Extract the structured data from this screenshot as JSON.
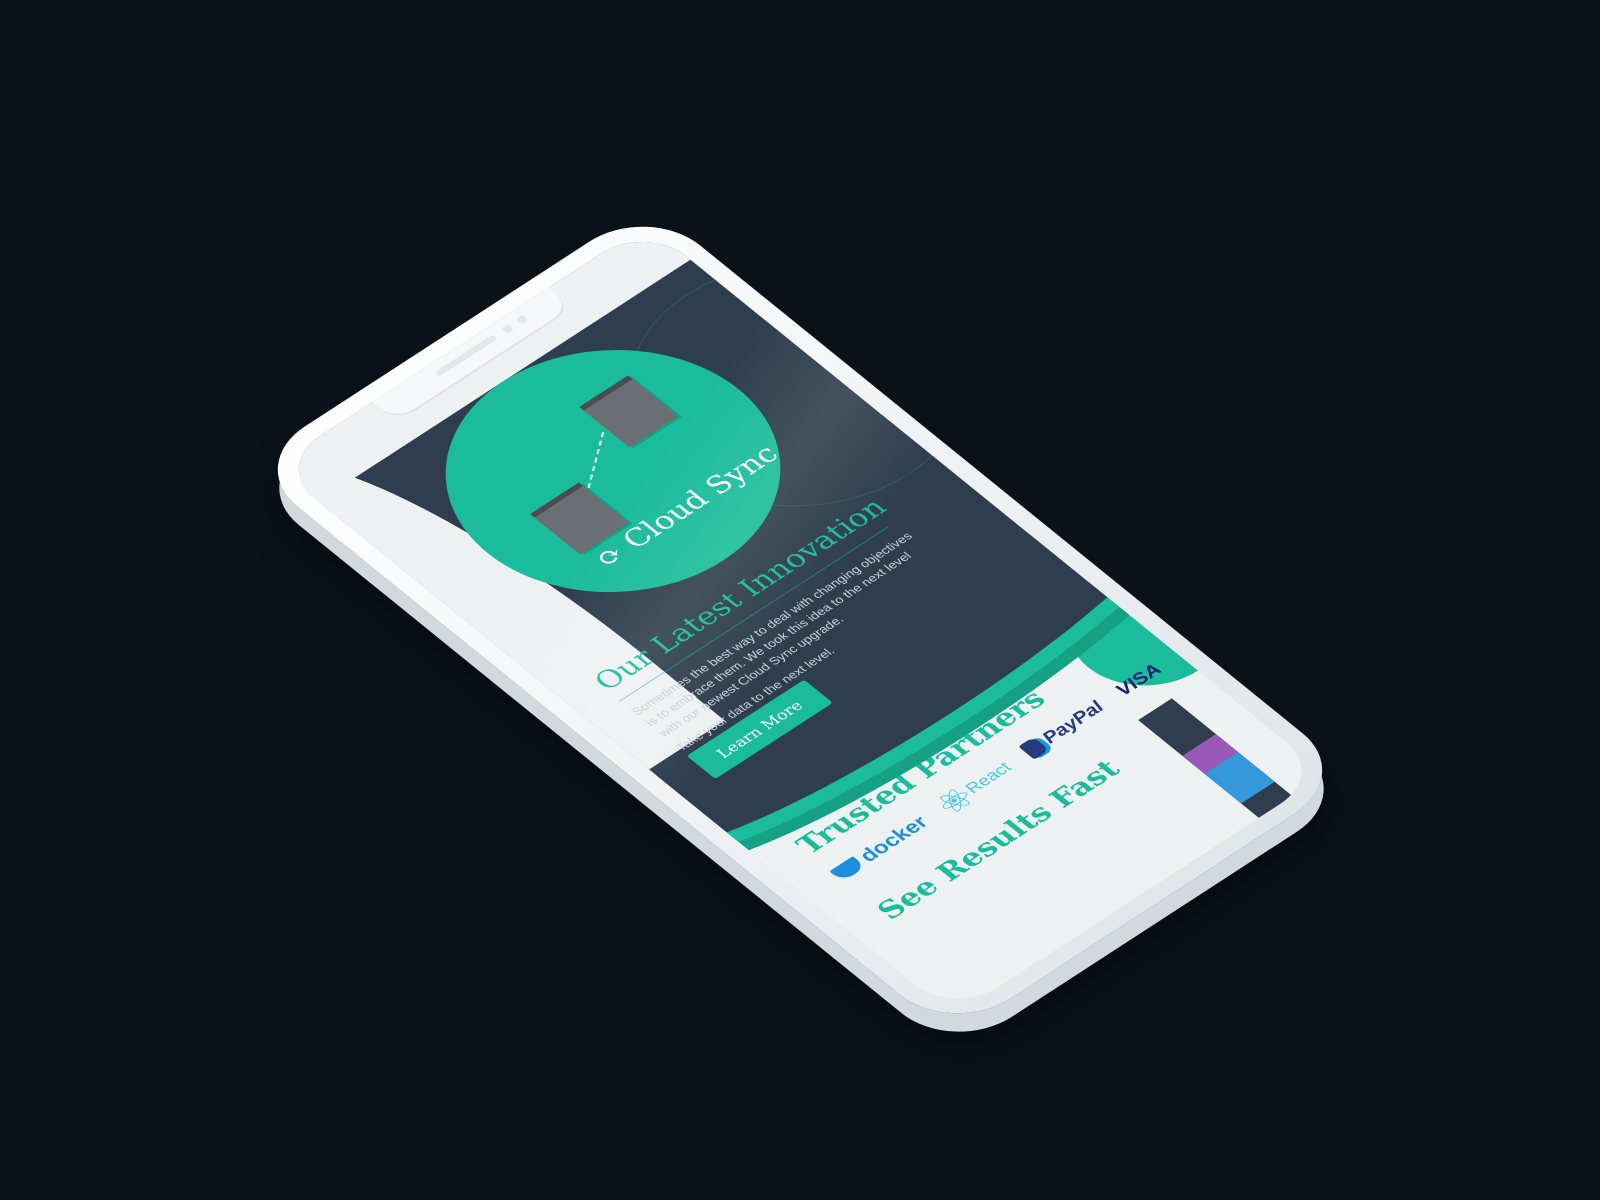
{
  "hero": {
    "badge_title": "Cloud Sync",
    "headline": "Our Latest Innovation",
    "paragraph": "Sometimes the best way to deal with changing objectives is to embrace them. We took this idea to the next level with our newest Cloud Sync upgrade.",
    "paragraph_2": "Take your data to the next level.",
    "cta_label": "Learn More"
  },
  "partners": {
    "title": "Trusted Partners",
    "logos": [
      "docker",
      "React",
      "PayPal",
      "VISA"
    ]
  },
  "results": {
    "title": "See Results Fast"
  },
  "colors": {
    "accent": "#1abc9c",
    "dark": "#2e3e4e",
    "light": "#eef1f2",
    "background": "#0b1219"
  }
}
